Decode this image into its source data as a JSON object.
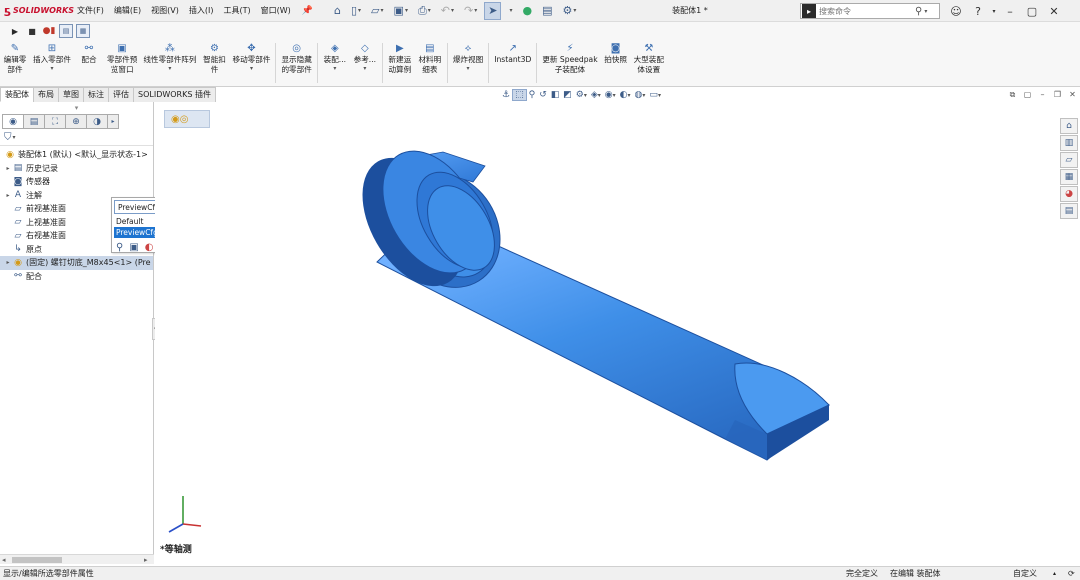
{
  "app": {
    "logo_text": "SOLIDWORKS",
    "document_title": "装配体1 *"
  },
  "menu": [
    "文件(F)",
    "编辑(E)",
    "视图(V)",
    "插入(I)",
    "工具(T)",
    "窗口(W)"
  ],
  "search": {
    "placeholder": "搜索命令"
  },
  "commands": [
    {
      "label": "编辑零\n部件",
      "icon": "edit-component-icon"
    },
    {
      "label": "插入零部件",
      "icon": "insert-component-icon",
      "dropdown": true
    },
    {
      "label": "配合",
      "icon": "mate-icon"
    },
    {
      "label": "零部件预\n览窗口",
      "icon": "component-preview-icon"
    },
    {
      "label": "线性零部件阵列",
      "icon": "linear-pattern-icon",
      "dropdown": true
    },
    {
      "label": "智能扣\n件",
      "icon": "smart-fasteners-icon"
    },
    {
      "label": "移动零部件",
      "icon": "move-component-icon",
      "dropdown": true
    },
    {
      "label": "显示隐藏\n的零部件",
      "icon": "show-hidden-icon"
    },
    {
      "label": "装配...",
      "icon": "assembly-features-icon",
      "dropdown": true
    },
    {
      "label": "参考...",
      "icon": "reference-geometry-icon",
      "dropdown": true
    },
    {
      "label": "新建运\n动算例",
      "icon": "new-motion-study-icon"
    },
    {
      "label": "材料明\n细表",
      "icon": "bill-of-materials-icon"
    },
    {
      "label": "爆炸视图",
      "icon": "exploded-view-icon",
      "dropdown": true
    },
    {
      "label": "Instant3D",
      "icon": "instant3d-icon"
    },
    {
      "label": "更新 Speedpak\n子装配体",
      "icon": "speedpak-icon"
    },
    {
      "label": "拍快照",
      "icon": "snapshot-icon"
    },
    {
      "label": "大型装配\n体设置",
      "icon": "large-assembly-icon"
    }
  ],
  "tabs": [
    "装配体",
    "布局",
    "草图",
    "标注",
    "评估",
    "SOLIDWORKS 插件"
  ],
  "active_tab": "装配体",
  "tree": [
    {
      "label": "装配体1 (默认) <默认_显示状态-1>",
      "icon": "assembly-icon",
      "expand": false,
      "indent": 0
    },
    {
      "label": "历史记录",
      "icon": "history-icon",
      "expand": true,
      "indent": 1
    },
    {
      "label": "传感器",
      "icon": "sensor-icon",
      "expand": false,
      "indent": 1
    },
    {
      "label": "注解",
      "icon": "annotations-icon",
      "expand": true,
      "indent": 1
    },
    {
      "label": "前视基准面",
      "icon": "plane-icon",
      "expand": false,
      "indent": 1
    },
    {
      "label": "上视基准面",
      "icon": "plane-icon",
      "expand": false,
      "indent": 1
    },
    {
      "label": "右视基准面",
      "icon": "plane-icon",
      "expand": false,
      "indent": 1
    },
    {
      "label": "原点",
      "icon": "origin-icon",
      "expand": false,
      "indent": 1
    },
    {
      "label": "(固定) 螺钉切底_M8x45<1> (Pre",
      "icon": "part-icon",
      "expand": true,
      "indent": 1,
      "selected": true
    },
    {
      "label": "配合",
      "icon": "mates-icon",
      "expand": false,
      "indent": 1
    }
  ],
  "config_popup": {
    "selected": "PreviewCfg",
    "options": [
      "Default",
      "PreviewCfg"
    ],
    "highlighted": "PreviewCfg"
  },
  "view_name": "*等轴测",
  "status": {
    "left": "显示/编辑所选零部件属性",
    "definition": "完全定义",
    "editing": "在编辑 装配体",
    "units": "自定义"
  },
  "colors": {
    "part_blue": "#3f8fe8",
    "part_dark": "#1c4f9e",
    "accent": "#1e74d0"
  }
}
